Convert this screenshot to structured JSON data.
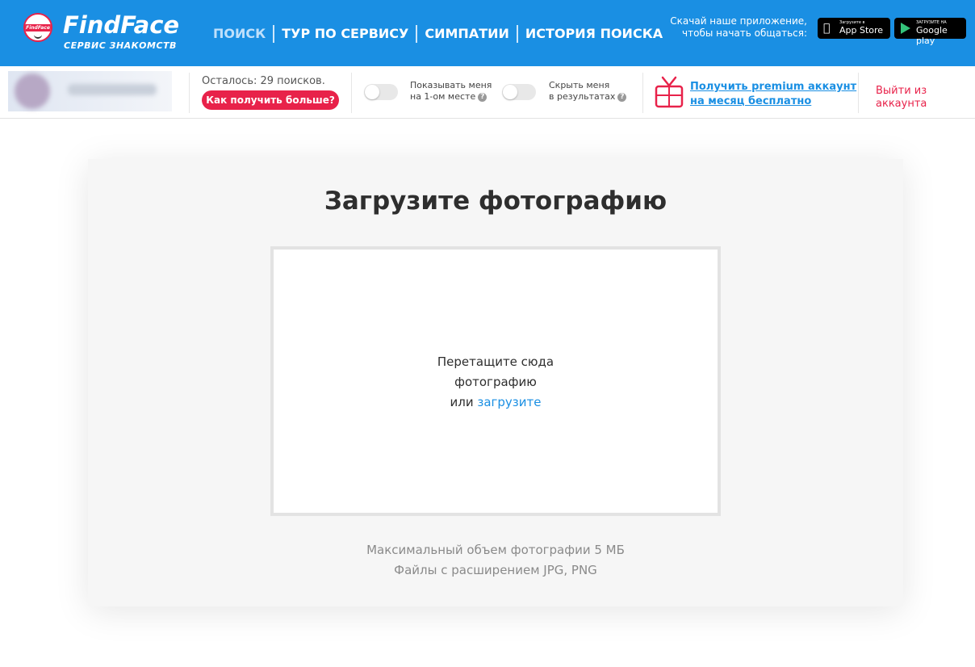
{
  "brand": {
    "logo_badge_text": "FindFace",
    "name": "FindFace",
    "subtitle": "СЕРВИС ЗНАКОМСТВ"
  },
  "nav": {
    "items": [
      {
        "label": "ПОИСК",
        "active": true
      },
      {
        "label": "ТУР ПО СЕРВИСУ",
        "active": false
      },
      {
        "label": "СИМПАТИИ",
        "active": false
      },
      {
        "label": "ИСТОРИЯ ПОИСКА",
        "active": false
      }
    ]
  },
  "app_promo": {
    "line1": "Скачай наше приложение,",
    "line2": "чтобы начать общаться:",
    "app_store": {
      "small": "Загрузите в",
      "big": "App Store",
      "icon": "apple-icon"
    },
    "google_play": {
      "small": "ЗАГРУЗИТЕ НА",
      "big": "Google play",
      "icon": "google-play-icon"
    }
  },
  "account_bar": {
    "remaining": "Осталось: 29 поисков.",
    "get_more_button": "Как получить больше?",
    "toggle_top": {
      "line1": "Показывать меня",
      "line2": "на 1-ом месте",
      "on": false
    },
    "toggle_hide": {
      "line1": "Скрыть меня",
      "line2": "в результатах",
      "on": false
    },
    "premium": {
      "line1": "Получить premium аккаунт",
      "line2": "месяц бесплатно",
      "prefix": "на "
    },
    "logout": "Выйти из аккаунта"
  },
  "upload": {
    "title": "Загрузите фотографию",
    "drop_line1": "Перетащите сюда",
    "drop_line2": "фотографию",
    "drop_or": "или ",
    "upload_link": "загрузите",
    "max_size": "Максимальный объем фотографии 5 МБ",
    "formats": "Файлы с расширением JPG, PNG"
  },
  "colors": {
    "header_blue": "#1a8fe3",
    "accent_red": "#e8224a",
    "card_bg": "#f6f6f6"
  }
}
